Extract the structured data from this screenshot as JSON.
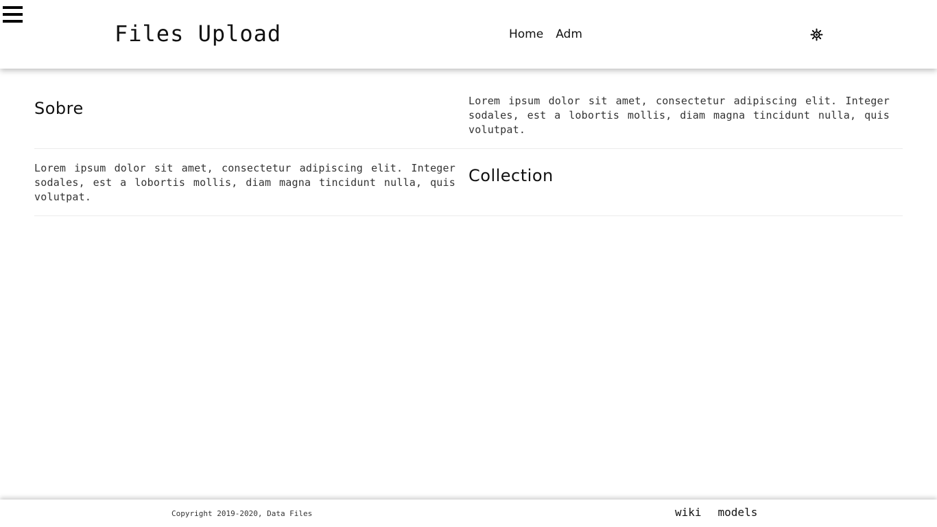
{
  "header": {
    "menu_icon": "hamburger-menu-icon",
    "title": "Files Upload",
    "nav": {
      "home": "Home",
      "adm": "Adm"
    },
    "theme_icon": "sun-icon"
  },
  "sections": [
    {
      "heading": "Sobre",
      "text": "Lorem ipsum dolor sit amet, consectetur adipiscing elit. Integer sodales, est a lobortis mollis, diam magna tincidunt nulla, quis volutpat."
    },
    {
      "heading": "Collection",
      "text": "Lorem ipsum dolor sit amet, consectetur adipiscing elit. Integer sodales, est a lobortis mollis, diam magna tincidunt nulla, quis volutpat."
    }
  ],
  "footer": {
    "copyright": "Copyright 2019-2020, Data Files",
    "links": {
      "wiki": "wiki",
      "models": "models"
    }
  },
  "colors": {
    "background": "#ffffff",
    "text": "#111111",
    "divider": "#ececec"
  }
}
